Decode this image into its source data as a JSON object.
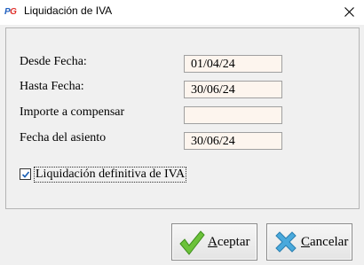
{
  "window": {
    "title": "Liquidación de IVA",
    "app_icon_text": "PG"
  },
  "form": {
    "desde_fecha": {
      "label": "Desde Fecha:",
      "value": "01/04/24"
    },
    "hasta_fecha": {
      "label": "Hasta Fecha:",
      "value": "30/06/24"
    },
    "importe_compensar": {
      "label": "Importe a compensar",
      "value": ""
    },
    "fecha_asiento": {
      "label": "Fecha del asiento",
      "value": "30/06/24"
    },
    "definitiva": {
      "label": "Liquidación definitiva de IVA",
      "checked": true
    }
  },
  "buttons": {
    "accept": {
      "mnemonic": "A",
      "rest": "ceptar",
      "icon": "check-icon"
    },
    "cancel": {
      "mnemonic": "C",
      "rest": "ancelar",
      "icon": "x-icon"
    }
  },
  "colors": {
    "field_bg": "#fdf5ee",
    "accept_icon": "#6cc23a",
    "cancel_icon": "#49a9dc",
    "logo_blue": "#1f5fbf",
    "logo_red": "#e0302a"
  }
}
